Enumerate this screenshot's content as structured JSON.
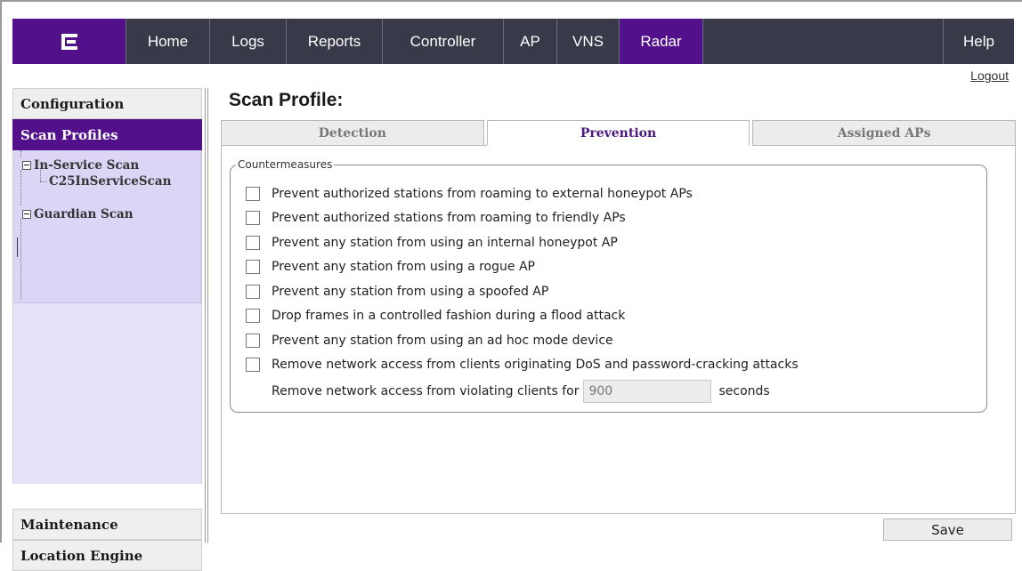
{
  "nav": {
    "items": [
      "Home",
      "Logs",
      "Reports",
      "Controller",
      "AP",
      "VNS",
      "Radar"
    ],
    "active": "Radar",
    "help": "Help",
    "logout": "Logout"
  },
  "sidebar": {
    "configuration": "Configuration",
    "scan_profiles": "Scan Profiles",
    "tree": {
      "in_service": "In-Service Scan",
      "in_service_child": "C25InServiceScan",
      "guardian": "Guardian Scan"
    },
    "maintenance": "Maintenance",
    "location_engine": "Location Engine"
  },
  "main": {
    "title": "Scan Profile:",
    "tabs": [
      "Detection",
      "Prevention",
      "Assigned APs"
    ],
    "active_tab": "Prevention",
    "fieldset_legend": "Countermeasures",
    "options": [
      {
        "label": "Prevent authorized stations from roaming to external honeypot APs",
        "checked": false
      },
      {
        "label": "Prevent authorized stations from roaming to friendly APs",
        "checked": false
      },
      {
        "label": "Prevent any station from using an internal honeypot AP",
        "checked": false
      },
      {
        "label": "Prevent any station from using a rogue AP",
        "checked": false
      },
      {
        "label": "Prevent any station from using a spoofed AP",
        "checked": false
      },
      {
        "label": "Drop frames in a controlled fashion during a flood attack",
        "checked": false
      },
      {
        "label": "Prevent any station from using an ad hoc mode device",
        "checked": false
      },
      {
        "label": "Remove network access from clients originating DoS and password-cracking attacks",
        "checked": false
      }
    ],
    "remove_label": "Remove network access from violating clients for",
    "remove_value": "900",
    "remove_unit": "seconds",
    "save": "Save"
  },
  "colors": {
    "brand_purple": "#52108a",
    "nav_bg": "#383a4a",
    "tree_bg": "#e8e3fa"
  }
}
